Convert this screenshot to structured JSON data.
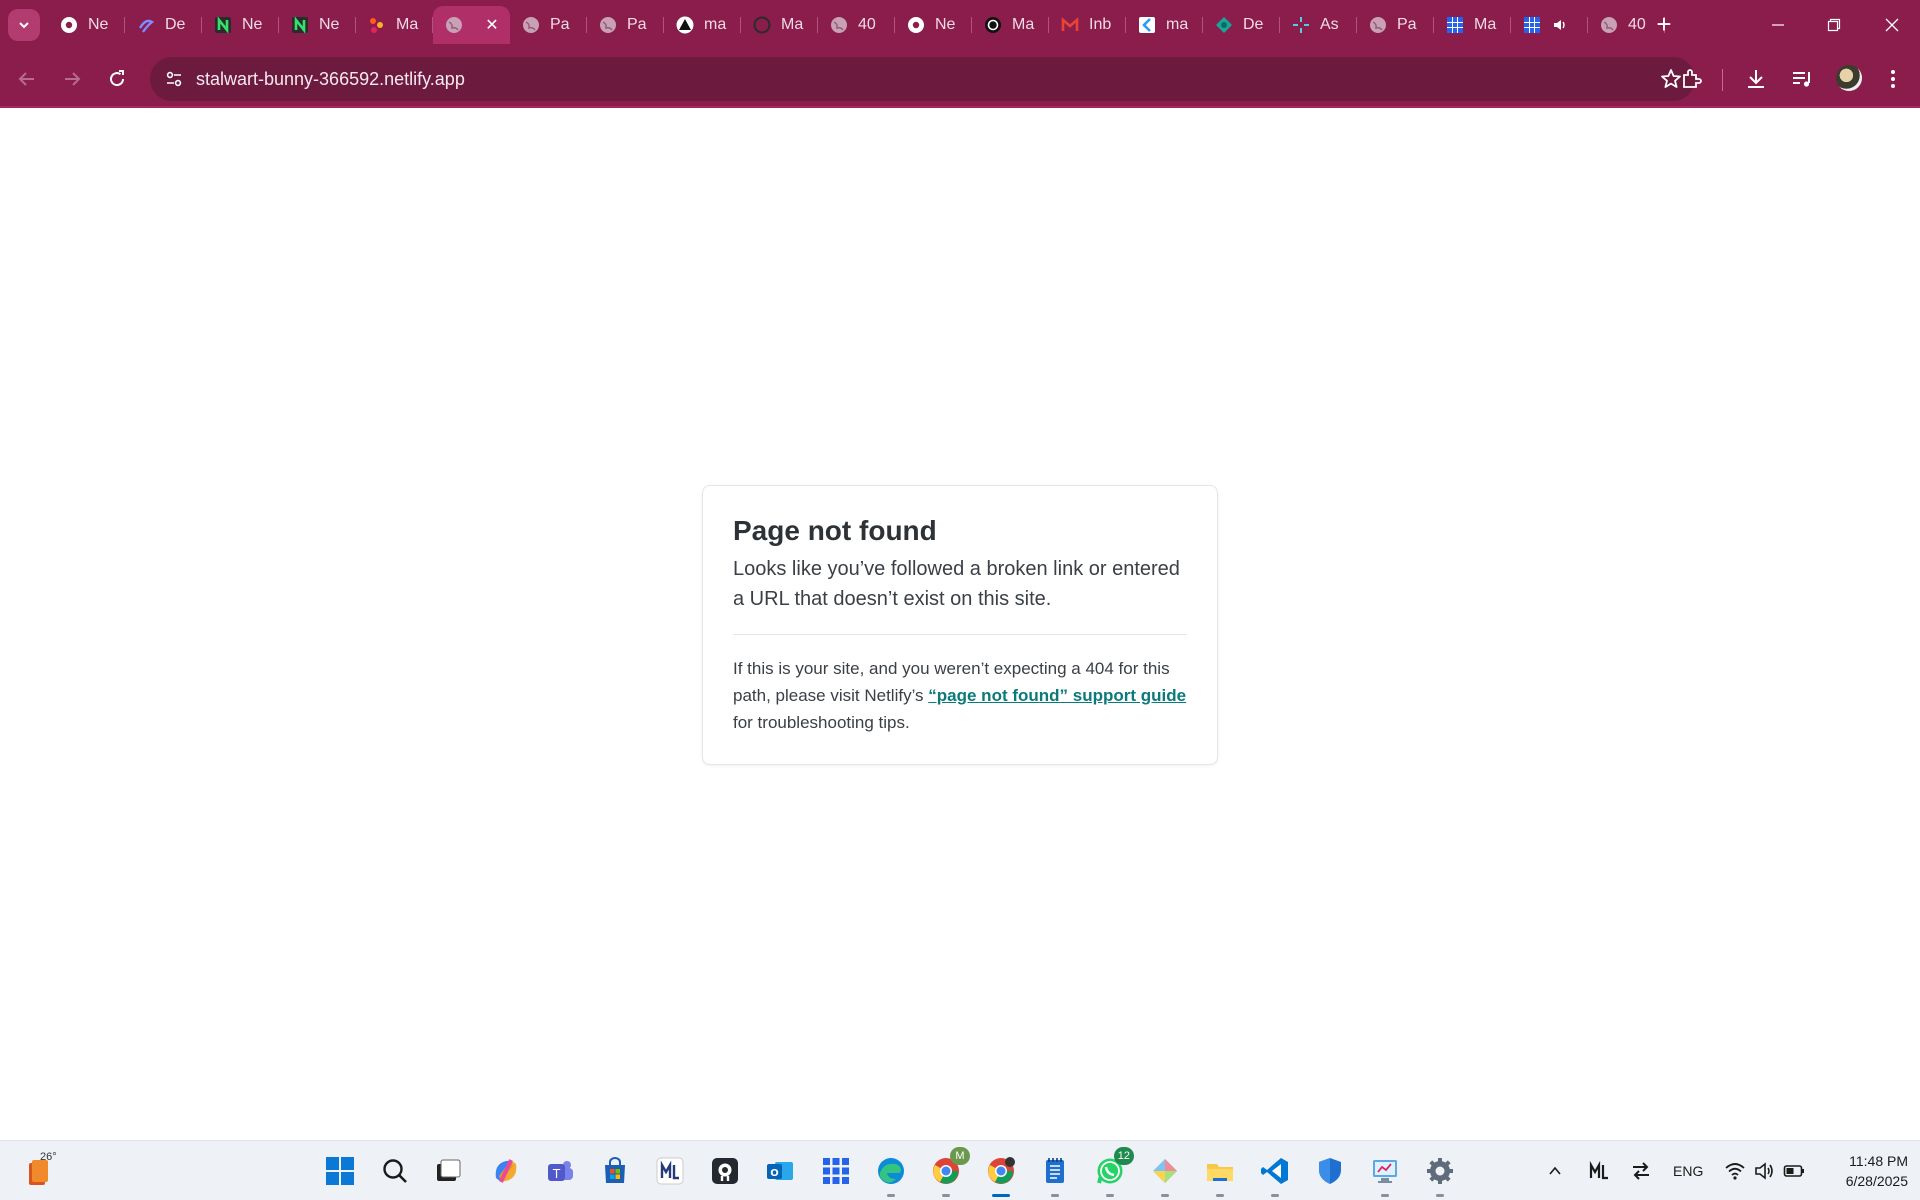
{
  "browser": {
    "tabs": [
      {
        "title": "Ne",
        "icon": "chrome-icon"
      },
      {
        "title": "De",
        "icon": "figma-style-icon"
      },
      {
        "title": "Ne",
        "icon": "n-logo-icon"
      },
      {
        "title": "Ne",
        "icon": "n-logo-icon"
      },
      {
        "title": "Ma",
        "icon": "make-logo-icon"
      },
      {
        "title": "",
        "icon": "globe-icon",
        "active": true
      },
      {
        "title": "Pa",
        "icon": "globe-icon"
      },
      {
        "title": "Pa",
        "icon": "globe-icon"
      },
      {
        "title": "ma",
        "icon": "triangle-logo-icon"
      },
      {
        "title": "Ma",
        "icon": "github-icon"
      },
      {
        "title": "40",
        "icon": "globe-icon"
      },
      {
        "title": "Ne",
        "icon": "chrome-icon"
      },
      {
        "title": "Ma",
        "icon": "openai-icon"
      },
      {
        "title": "Inb",
        "icon": "gmail-icon"
      },
      {
        "title": "ma",
        "icon": "k-logo-icon"
      },
      {
        "title": "De",
        "icon": "teal-logo-icon"
      },
      {
        "title": "As",
        "icon": "sparkle-icon"
      },
      {
        "title": "Pa",
        "icon": "globe-icon"
      },
      {
        "title": "Ma",
        "icon": "grid-icon"
      },
      {
        "title": "",
        "icon": "grid-icon",
        "audio": true
      },
      {
        "title": "40",
        "icon": "globe-icon"
      }
    ],
    "url": "stalwart-bunny-366592.netlify.app",
    "colors": {
      "frame": "#8a1d4b",
      "active_tab": "#b02f69",
      "omnibox": "#6d1a3f"
    }
  },
  "page": {
    "title": "Page not found",
    "lead": "Looks like you’ve followed a broken link or entered a URL that doesn’t exist on this site.",
    "detail_prefix": "If this is your site, and you weren’t expecting a 404 for this path, please visit Netlify’s ",
    "detail_link": "“page not found” support guide",
    "detail_suffix": " for troubleshooting tips.",
    "link_color": "#0b7a7a"
  },
  "taskbar": {
    "weather_temp": "26°",
    "whatsapp_badge": "12",
    "chrome_profile_badge": "M",
    "language": "ENG",
    "time": "11:48 PM",
    "date": "6/28/2025"
  }
}
